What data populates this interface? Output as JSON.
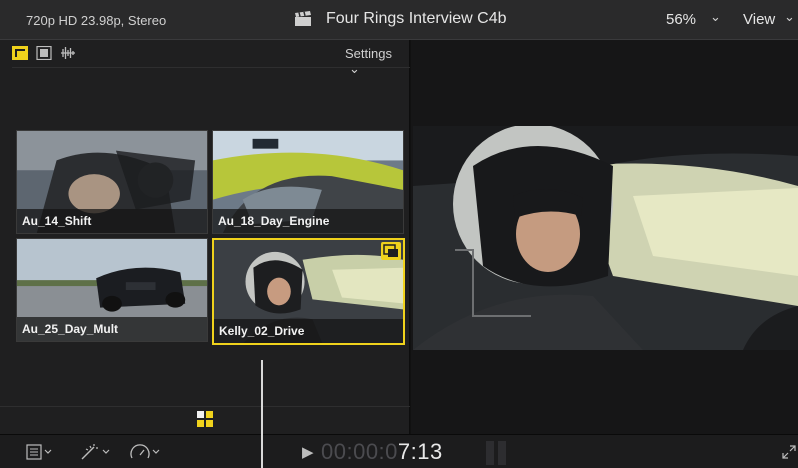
{
  "topbar": {
    "format": "720p HD 23.98p, Stereo",
    "title": "Four Rings Interview C4b",
    "zoom": "56%",
    "view": "View"
  },
  "browser": {
    "settings_label": "Settings",
    "clips": [
      {
        "label": "Au_14_Shift",
        "selected": false
      },
      {
        "label": "Au_18_Day_Engine",
        "selected": false
      },
      {
        "label": "Au_25_Day_Mult",
        "selected": false
      },
      {
        "label": "Kelly_02_Drive",
        "selected": true
      }
    ]
  },
  "viewer": {
    "timecode_dim": "00:00:0",
    "timecode_bright": "7:13"
  },
  "icons": {
    "clapper": "clapperboard-icon",
    "clip_appearance": "filmstrip-icon",
    "waveform": "waveform-icon",
    "grid": "grid-icon",
    "play": "play-icon",
    "fullscreen": "fullscreen-icon"
  },
  "colors": {
    "accent_yellow": "#f0d21c",
    "background": "#1f1f20",
    "topbar": "#2a2a2b"
  }
}
